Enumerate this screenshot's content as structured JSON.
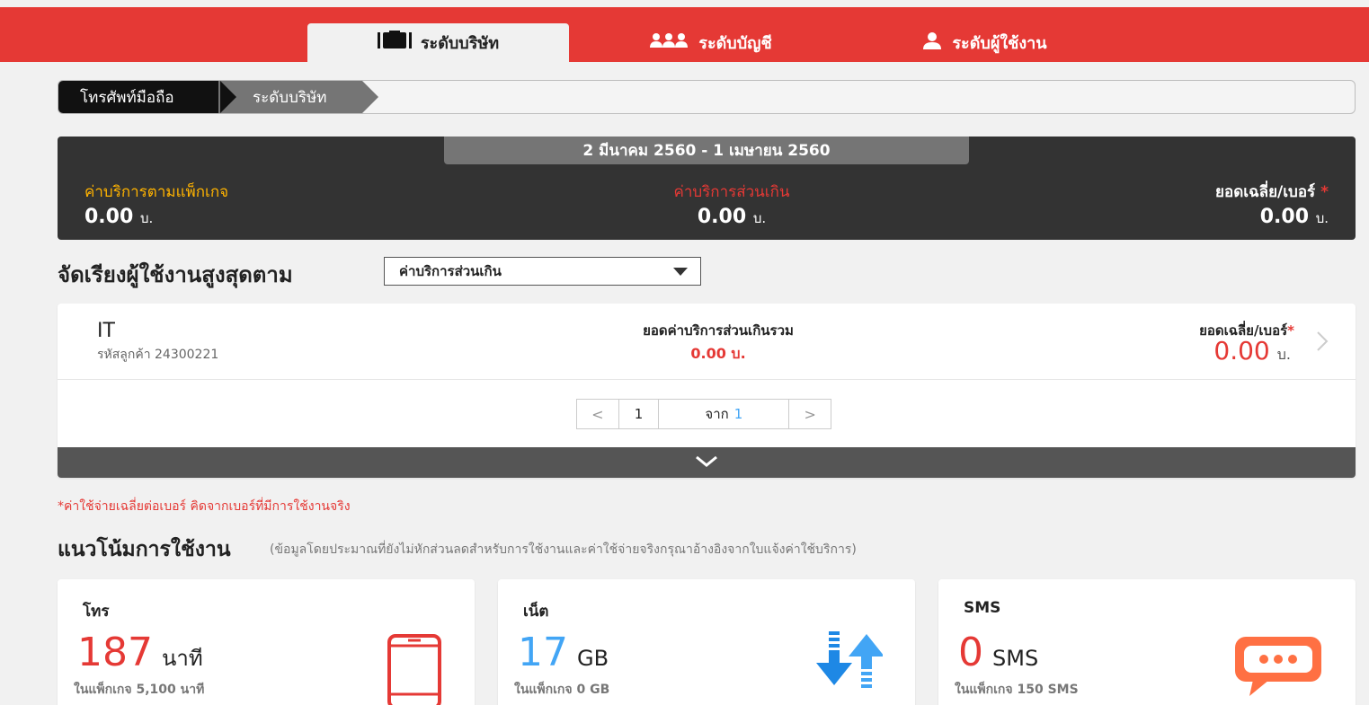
{
  "nav": {
    "tabs": [
      {
        "label": "ระดับบริษัท",
        "icon": "briefcase-icon",
        "active": true
      },
      {
        "label": "ระดับบัญชี",
        "icon": "users-icon",
        "active": false
      },
      {
        "label": "ระดับผู้ใช้งาน",
        "icon": "user-icon",
        "active": false
      }
    ]
  },
  "breadcrumb": {
    "items": [
      "โทรศัพท์มือถือ",
      "ระดับบริษัท"
    ]
  },
  "summary": {
    "period": "2 มีนาคม 2560 - 1 เมษายน 2560",
    "package_label": "ค่าบริการตามแพ็กเกจ",
    "package_value": "0.00",
    "overage_label": "ค่าบริการส่วนเกิน",
    "overage_value": "0.00",
    "average_label": "ยอดเฉลี่ย/เบอร์",
    "average_value": "0.00",
    "star": "*",
    "currency": "บ."
  },
  "sort": {
    "title": "จัดเรียงผู้ใช้งานสูงสุดตาม",
    "selected": "ค่าบริการส่วนเกิน"
  },
  "customer": {
    "name": "IT",
    "code": "รหัสลูกค้า 24300221",
    "overage_label": "ยอดค่าบริการส่วนเกินรวม",
    "overage_value": "0.00 บ.",
    "avg_label": "ยอดเฉลี่ย/เบอร์",
    "avg_value": "0.00",
    "currency": "บ."
  },
  "pagination": {
    "prev": "<",
    "current": "1",
    "of_label": "จาก",
    "total": "1",
    "next": ">"
  },
  "footnote": "*ค่าใช้จ่ายเฉลี่ยต่อเบอร์ คิดจากเบอร์ที่มีการใช้งานจริง",
  "trend": {
    "title": "แนวโน้มการใช้งาน",
    "subtitle": "(ข้อมูลโดยประมาณที่ยังไม่หักส่วนลดสำหรับการใช้งานและค่าใช้จ่ายจริงกรุณาอ้างอิงจากใบแจ้งค่าใช้บริการ)"
  },
  "usage": [
    {
      "title": "โทร",
      "value": "187",
      "unit": "นาที",
      "package": "ในแพ็กเกจ 5,100 นาที",
      "color": "#e53935",
      "icon": "phone-icon"
    },
    {
      "title": "เน็ต",
      "value": "17",
      "unit": "GB",
      "package": "ในแพ็กเกจ 0 GB",
      "color": "#42a5f5",
      "icon": "data-transfer-icon"
    },
    {
      "title": "SMS",
      "value": "0",
      "unit": "SMS",
      "package": "ในแพ็กเกจ 150 SMS",
      "color": "#e53935",
      "icon": "chat-icon"
    }
  ]
}
